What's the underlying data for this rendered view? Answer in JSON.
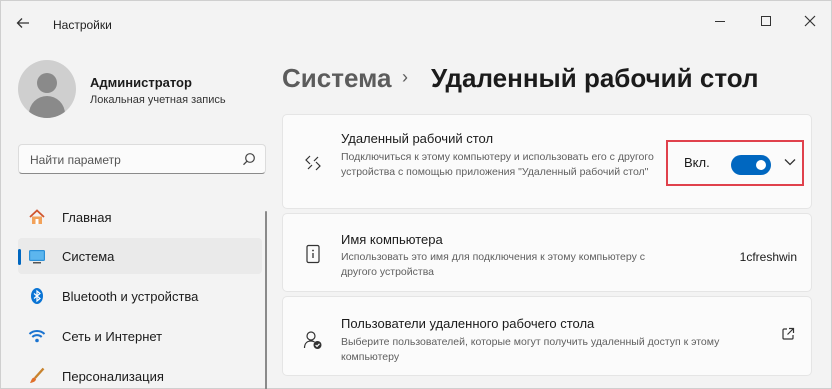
{
  "window": {
    "title": "Настройки",
    "back_icon": "back-arrow-icon",
    "minimize_icon": "minimize-icon",
    "maximize_icon": "maximize-icon",
    "close_icon": "close-icon"
  },
  "profile": {
    "name": "Администратор",
    "account_type": "Локальная учетная запись"
  },
  "search": {
    "placeholder": "Найти параметр",
    "icon": "search-icon"
  },
  "nav": {
    "items": [
      {
        "label": "Главная",
        "icon": "home-icon",
        "active": false
      },
      {
        "label": "Система",
        "icon": "system-icon",
        "active": true
      },
      {
        "label": "Bluetooth и устройства",
        "icon": "bluetooth-icon",
        "active": false
      },
      {
        "label": "Сеть и Интернет",
        "icon": "wifi-icon",
        "active": false
      },
      {
        "label": "Персонализация",
        "icon": "brush-icon",
        "active": false
      }
    ]
  },
  "breadcrumb": {
    "parent": "Система",
    "separator": "›",
    "current": "Удаленный рабочий стол"
  },
  "cards": {
    "remote_desktop": {
      "title": "Удаленный рабочий стол",
      "description": "Подключиться к этому компьютеру и использовать его с другого устройства с помощью приложения \"Удаленный рабочий стол\"",
      "toggle_label": "Вкл.",
      "toggle_on": true,
      "icon": "remote-desktop-icon"
    },
    "pc_name": {
      "title": "Имя компьютера",
      "description": "Использовать это имя для подключения к этому компьютеру с другого устройства",
      "value": "1cfreshwin",
      "icon": "pc-name-icon"
    },
    "users": {
      "title": "Пользователи удаленного рабочего стола",
      "description": "Выберите пользователей, которые могут получить удаленный доступ к этому компьютеру",
      "icon": "users-icon",
      "link_icon": "external-link-icon"
    }
  },
  "colors": {
    "accent": "#0067c0",
    "highlight_border": "#e0414c",
    "background": "#f3f3f3"
  }
}
